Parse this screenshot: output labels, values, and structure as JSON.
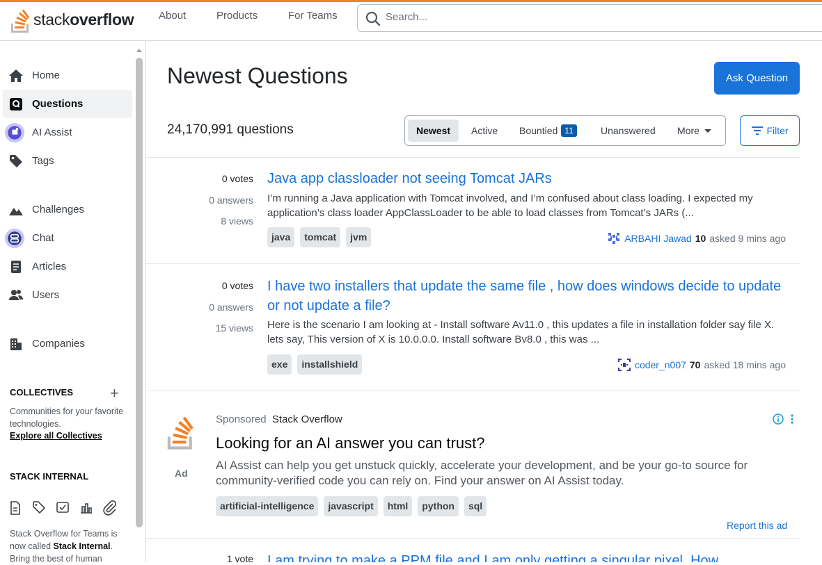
{
  "header": {
    "logo_text_regular": "stack",
    "logo_text_bold": "overflow",
    "nav": [
      "About",
      "Products",
      "For Teams"
    ],
    "search_placeholder": "Search..."
  },
  "sidebar": {
    "items": [
      {
        "label": "Home"
      },
      {
        "label": "Questions"
      },
      {
        "label": "AI Assist"
      },
      {
        "label": "Tags"
      },
      {
        "label": "Challenges"
      },
      {
        "label": "Chat"
      },
      {
        "label": "Articles"
      },
      {
        "label": "Users"
      },
      {
        "label": "Companies"
      }
    ],
    "collectives_heading": "COLLECTIVES",
    "collectives_text": "Communities for your favorite technologies.",
    "collectives_link": "Explore all Collectives",
    "stack_internal_heading": "STACK INTERNAL",
    "stack_internal_text_a": "Stack Overflow for Teams is now called ",
    "stack_internal_text_b": "Stack Internal",
    "stack_internal_text_c": ". Bring the best of human"
  },
  "main": {
    "title": "Newest Questions",
    "ask_button": "Ask Question",
    "question_count": "24,170,991 questions",
    "filter_tabs": [
      "Newest",
      "Active",
      "Bountied",
      "Unanswered",
      "More"
    ],
    "bountied_count": "11",
    "filter_button": "Filter",
    "questions": [
      {
        "votes": "0 votes",
        "answers": "0 answers",
        "views": "8 views",
        "title": "Java app classloader not seeing Tomcat JARs",
        "excerpt": "I’m running a Java application with Tomcat involved, and I’m confused about class loading. I expected my application’s class loader AppClassLoader to be able to load classes from Tomcat’s JARs (...",
        "tags": [
          "java",
          "tomcat",
          "jvm"
        ],
        "user": "ARBAHI Jawad",
        "rep": "10",
        "asked": "asked 9 mins ago"
      },
      {
        "votes": "0 votes",
        "answers": "0 answers",
        "views": "15 views",
        "title": "I have two installers that update the same file , how does windows decide to update or not update a file?",
        "excerpt": "Here is the scenario I am looking at - Install software Av11.0 , this updates a file in installation folder say file X. lets say, This version of X is 10.0.0.0. Install software Bv8.0 , this was ...",
        "tags": [
          "exe",
          "installshield"
        ],
        "user": "coder_n007",
        "rep": "70",
        "asked": "asked 18 mins ago"
      }
    ],
    "ad": {
      "label": "Ad",
      "sponsored": "Sponsored",
      "sponsor": "Stack Overflow",
      "title": "Looking for an AI answer you can trust?",
      "body": "AI Assist can help you get unstuck quickly, accelerate your development, and be your go-to source for community-verified code you can rely on. Find your answer on AI Assist today.",
      "tags": [
        "artificial-intelligence",
        "javascript",
        "html",
        "python",
        "sql"
      ],
      "report": "Report this ad"
    },
    "next_question": {
      "votes": "1 vote",
      "title": "I am trying to make a PPM file and I am only getting a singular pixel. How"
    }
  },
  "colors": {
    "accent": "#f48225",
    "link": "#1a73d9",
    "button": "#1a73d9",
    "badge": "#0a5ca8"
  }
}
